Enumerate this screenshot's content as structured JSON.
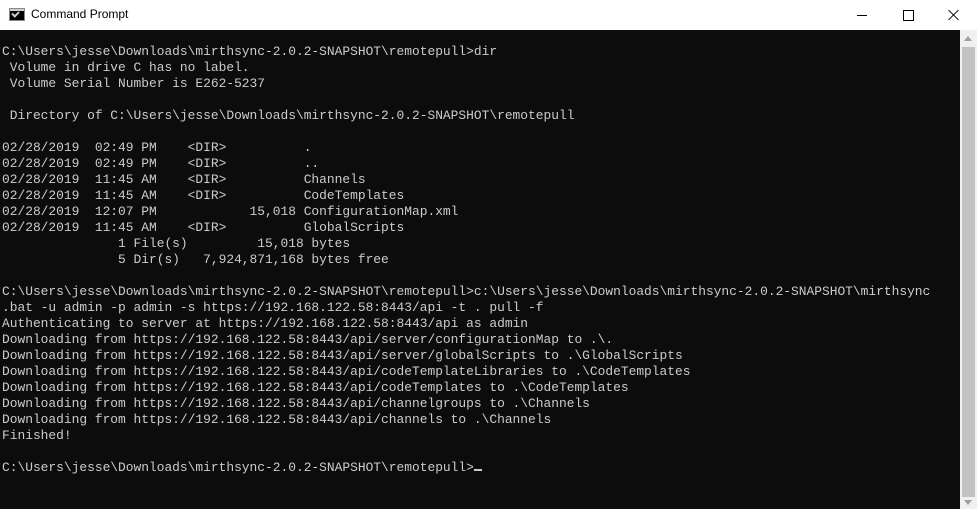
{
  "window": {
    "title": "Command Prompt",
    "icon": "cmd-icon"
  },
  "console": {
    "lines": [
      "C:\\Users\\jesse\\Downloads\\mirthsync-2.0.2-SNAPSHOT\\remotepull>dir",
      " Volume in drive C has no label.",
      " Volume Serial Number is E262-5237",
      "",
      " Directory of C:\\Users\\jesse\\Downloads\\mirthsync-2.0.2-SNAPSHOT\\remotepull",
      "",
      "02/28/2019  02:49 PM    <DIR>          .",
      "02/28/2019  02:49 PM    <DIR>          ..",
      "02/28/2019  11:45 AM    <DIR>          Channels",
      "02/28/2019  11:45 AM    <DIR>          CodeTemplates",
      "02/28/2019  12:07 PM            15,018 ConfigurationMap.xml",
      "02/28/2019  11:45 AM    <DIR>          GlobalScripts",
      "               1 File(s)         15,018 bytes",
      "               5 Dir(s)   7,924,871,168 bytes free",
      "",
      "C:\\Users\\jesse\\Downloads\\mirthsync-2.0.2-SNAPSHOT\\remotepull>c:\\Users\\jesse\\Downloads\\mirthsync-2.0.2-SNAPSHOT\\mirthsync",
      ".bat -u admin -p admin -s https://192.168.122.58:8443/api -t . pull -f",
      "Authenticating to server at https://192.168.122.58:8443/api as admin",
      "Downloading from https://192.168.122.58:8443/api/server/configurationMap to .\\.",
      "Downloading from https://192.168.122.58:8443/api/server/globalScripts to .\\GlobalScripts",
      "Downloading from https://192.168.122.58:8443/api/codeTemplateLibraries to .\\CodeTemplates",
      "Downloading from https://192.168.122.58:8443/api/codeTemplates to .\\CodeTemplates",
      "Downloading from https://192.168.122.58:8443/api/channelgroups to .\\Channels",
      "Downloading from https://192.168.122.58:8443/api/channels to .\\Channels",
      "Finished!",
      ""
    ],
    "prompt": "C:\\Users\\jesse\\Downloads\\mirthsync-2.0.2-SNAPSHOT\\remotepull>"
  },
  "colors": {
    "console_bg": "#0c0c0c",
    "console_fg": "#cccccc",
    "titlebar_bg": "#ffffff"
  }
}
